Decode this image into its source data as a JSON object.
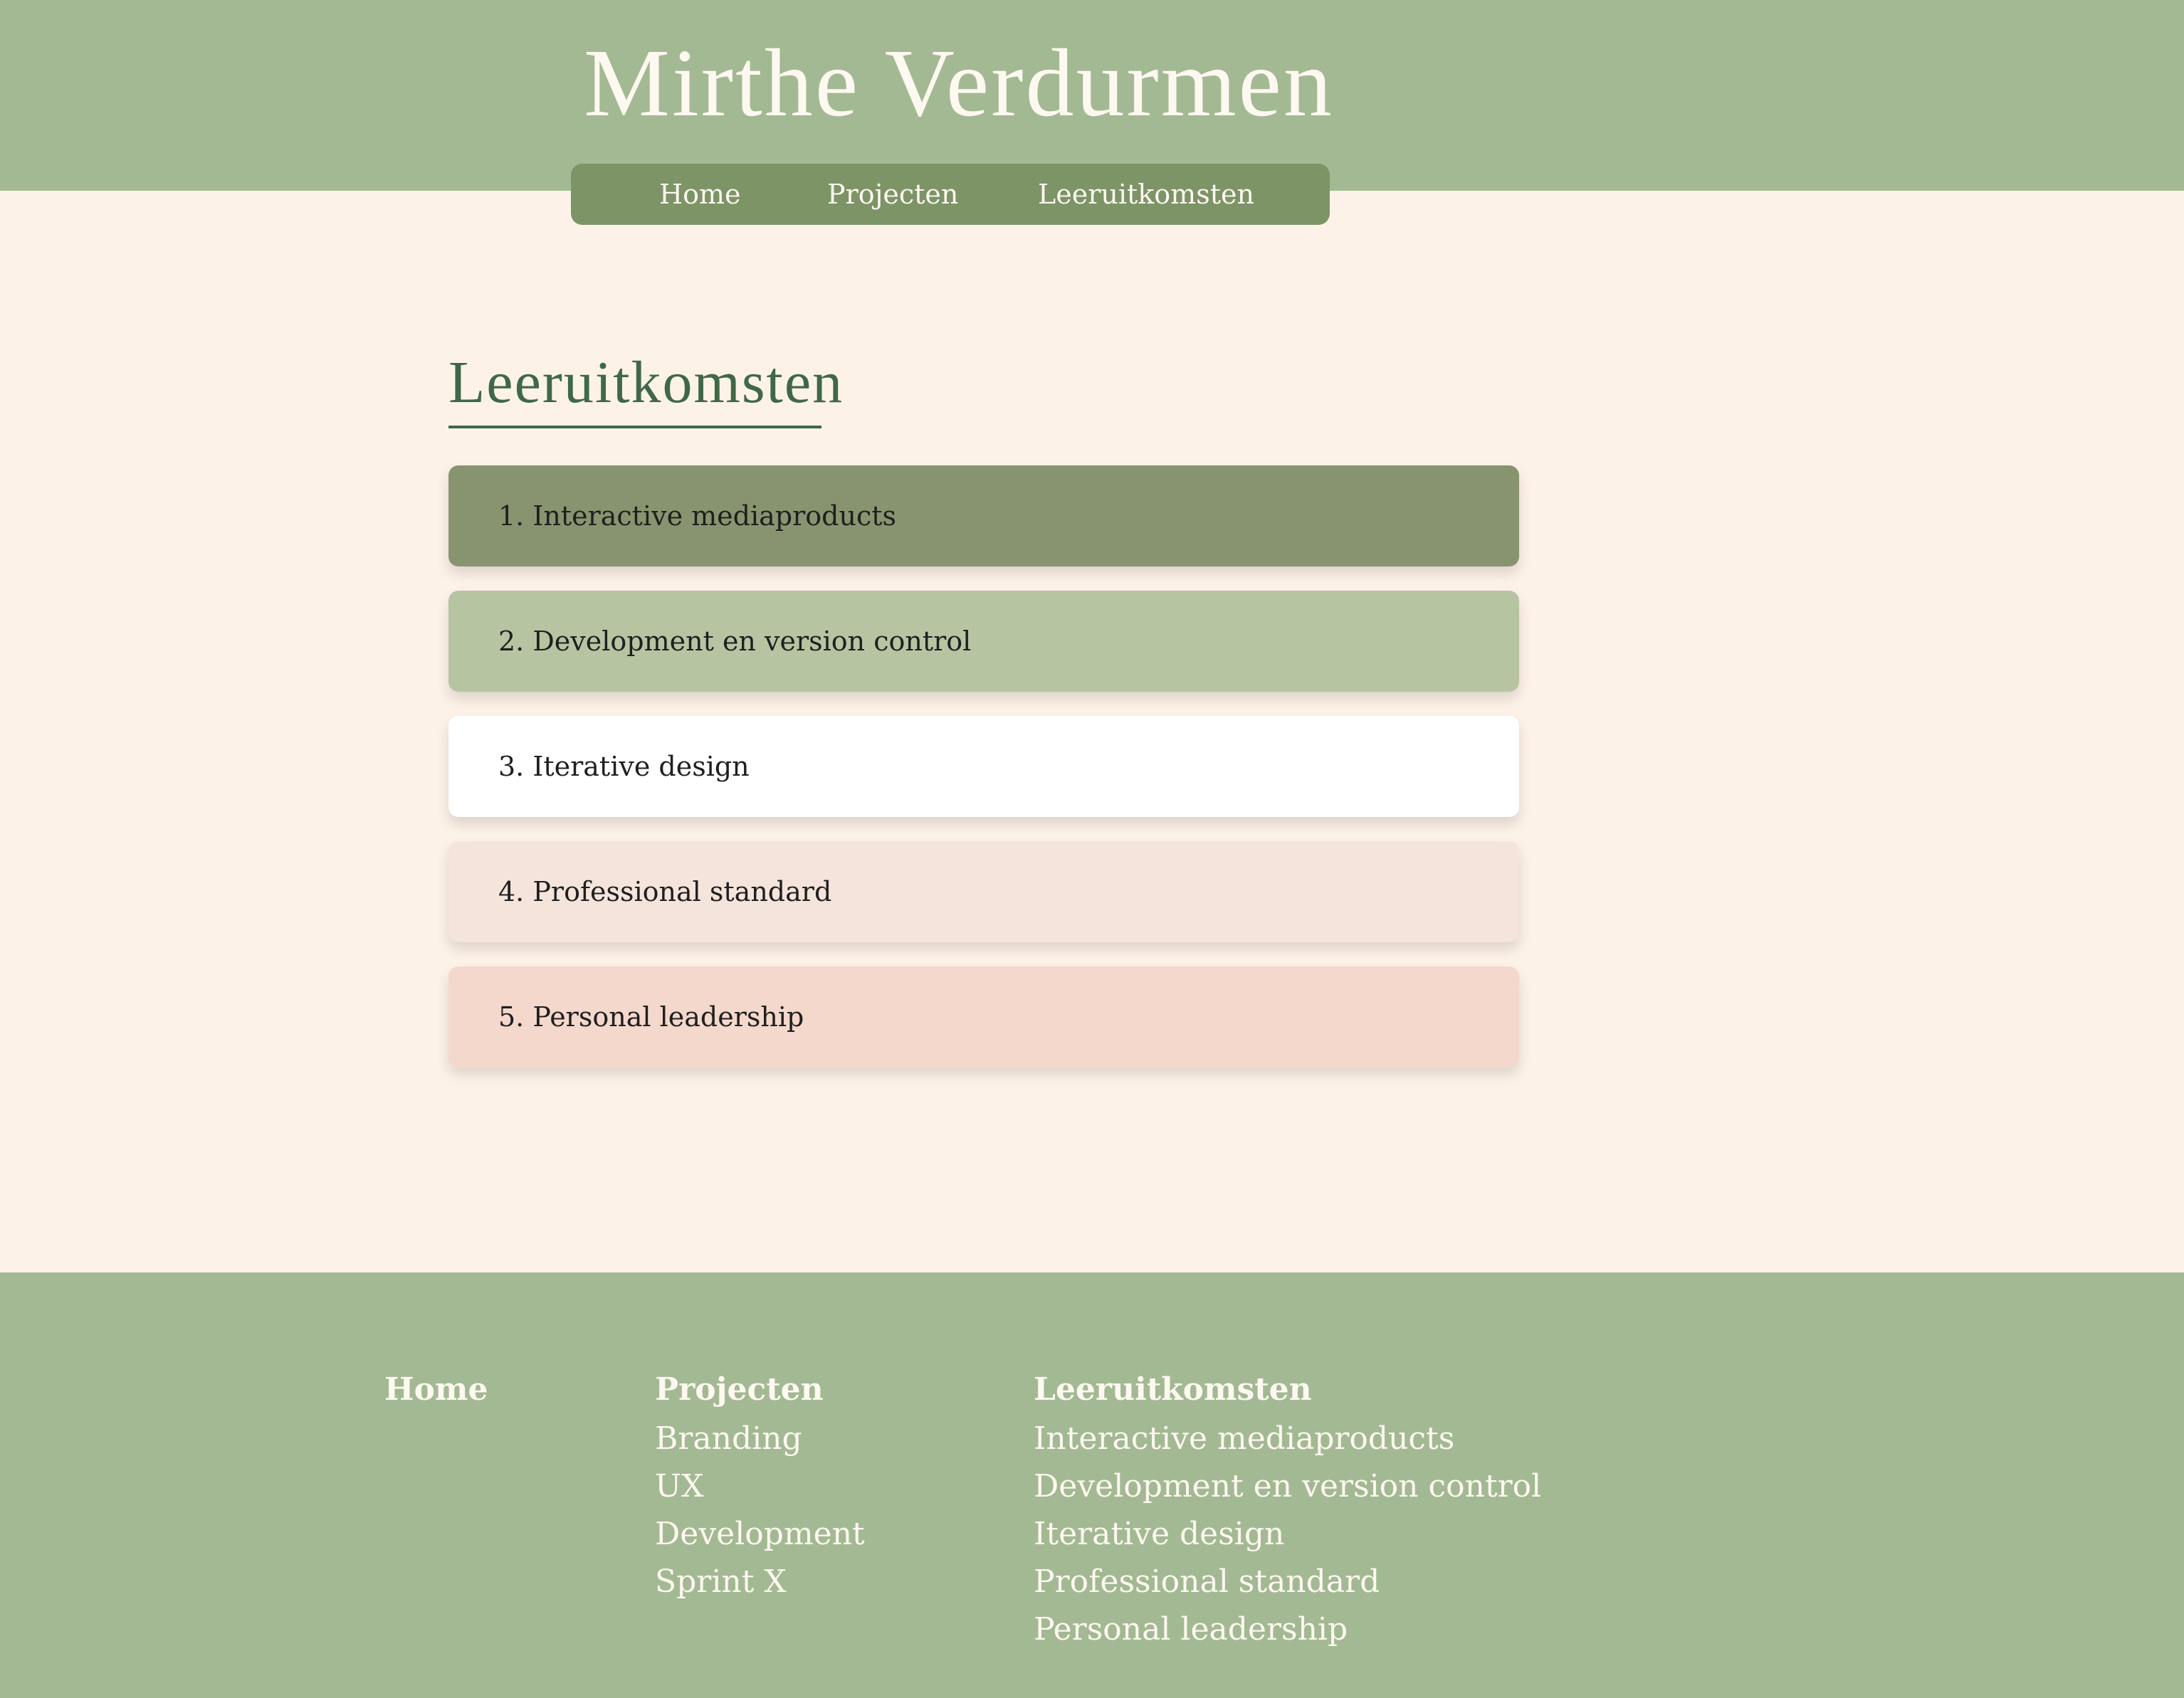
{
  "site": {
    "title": "Mirthe Verdurmen"
  },
  "nav": {
    "items": [
      "Home",
      "Projecten",
      "Leeruitkomsten"
    ]
  },
  "page": {
    "heading": "Leeruitkomsten"
  },
  "outcomes": [
    {
      "label": "1. Interactive mediaproducts",
      "color": "#88946f"
    },
    {
      "label": "2. Development en version control",
      "color": "#b6c4a2"
    },
    {
      "label": "3. Iterative design",
      "color": "#ffffff"
    },
    {
      "label": "4. Professional standard",
      "color": "#f5e4db"
    },
    {
      "label": "5. Personal leadership",
      "color": "#f4d8cc"
    }
  ],
  "footer": {
    "home": {
      "heading": "Home"
    },
    "projecten": {
      "heading": "Projecten",
      "links": [
        "Branding",
        "UX",
        "Development",
        "Sprint X"
      ]
    },
    "leeruitkomsten": {
      "heading": "Leeruitkomsten",
      "links": [
        "Interactive mediaproducts",
        "Development en version control",
        "Iterative design",
        "Professional standard",
        "Personal leadership"
      ]
    }
  },
  "colors": {
    "header_bg": "#a3b993",
    "nav_bg": "#7d9467",
    "page_bg": "#fdf2e8",
    "heading": "#3f6848",
    "footer_bg": "#a3b993",
    "light_text": "#fdf8f0"
  }
}
